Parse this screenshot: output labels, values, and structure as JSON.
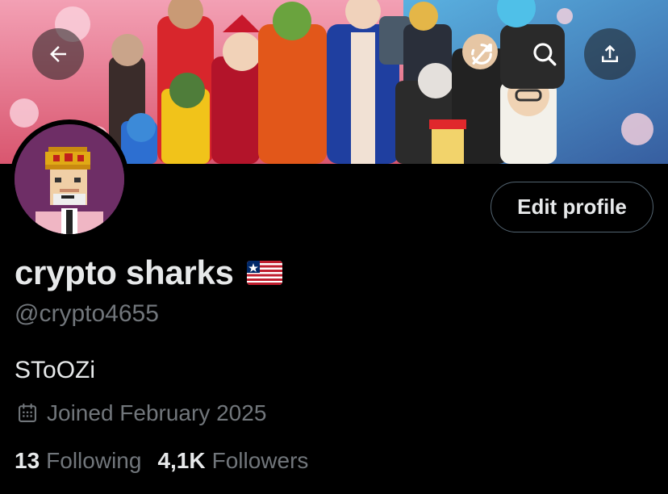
{
  "header": {
    "back_icon": "arrow-left-icon",
    "refresh_icon": "refresh-icon",
    "search_icon": "search-icon",
    "share_icon": "share-upload-icon"
  },
  "profile": {
    "display_name": "crypto sharks",
    "flag": "Liberia flag emoji",
    "handle": "@crypto4655",
    "bio": "SToOZi",
    "joined": "Joined February 2025",
    "edit_label": "Edit profile"
  },
  "stats": {
    "following_count": "13",
    "following_label": "Following",
    "followers_count": "4,1K",
    "followers_label": "Followers"
  },
  "colors": {
    "background": "#000000",
    "text_primary": "#e7e9ea",
    "text_secondary": "#71767b",
    "button_border": "#536471",
    "banner_pink": "#e8738c",
    "avatar_bg": "#6e2e66"
  }
}
